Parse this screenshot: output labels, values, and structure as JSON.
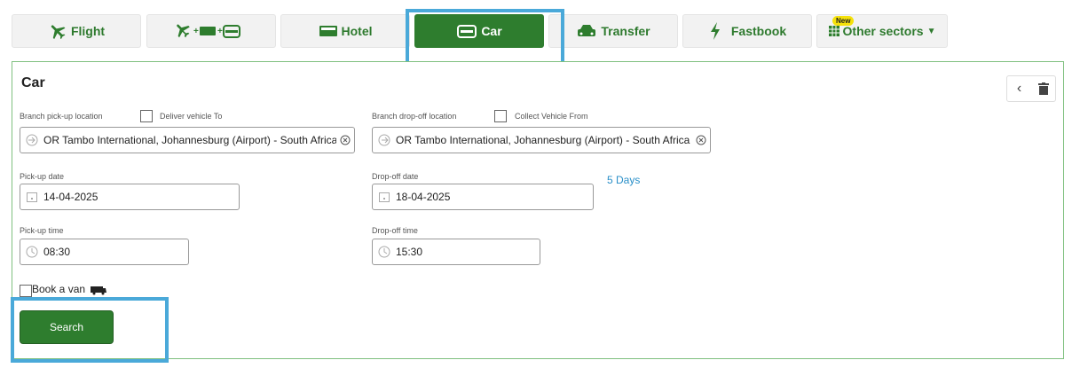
{
  "tabs": [
    {
      "id": "flight",
      "label": "Flight",
      "icon": "plane-icon"
    },
    {
      "id": "package",
      "label": "",
      "icon": "plane-hotel-car-icon"
    },
    {
      "id": "hotel",
      "label": "Hotel",
      "icon": "bed-icon"
    },
    {
      "id": "car",
      "label": "Car",
      "icon": "car-icon",
      "active": true
    },
    {
      "id": "transfer",
      "label": "Transfer",
      "icon": "taxi-icon"
    },
    {
      "id": "fastbook",
      "label": "Fastbook",
      "icon": "bolt-icon"
    },
    {
      "id": "other",
      "label": "Other sectors",
      "icon": "grid-icon",
      "badge": "New"
    }
  ],
  "panel": {
    "title": "Car",
    "pickup_location_label": "Branch pick-up location",
    "deliver_vehicle_label": "Deliver vehicle To",
    "pickup_location_value": "OR Tambo International, Johannesburg (Airport) - South Africa",
    "dropoff_location_label": "Branch drop-off location",
    "collect_vehicle_label": "Collect Vehicle From",
    "dropoff_location_value": "OR Tambo International, Johannesburg (Airport) - South Africa",
    "pickup_date_label": "Pick-up date",
    "pickup_date_value": "14-04-2025",
    "dropoff_date_label": "Drop-off date",
    "dropoff_date_value": "18-04-2025",
    "duration": "5 Days",
    "pickup_time_label": "Pick-up time",
    "pickup_time_value": "08:30",
    "dropoff_time_label": "Drop-off time",
    "dropoff_time_value": "15:30",
    "book_van_label": "Book a van",
    "search_label": "Search"
  },
  "colors": {
    "accent": "#2e7d2e",
    "highlight": "#4aa9d9",
    "link": "#2a8fc8"
  }
}
